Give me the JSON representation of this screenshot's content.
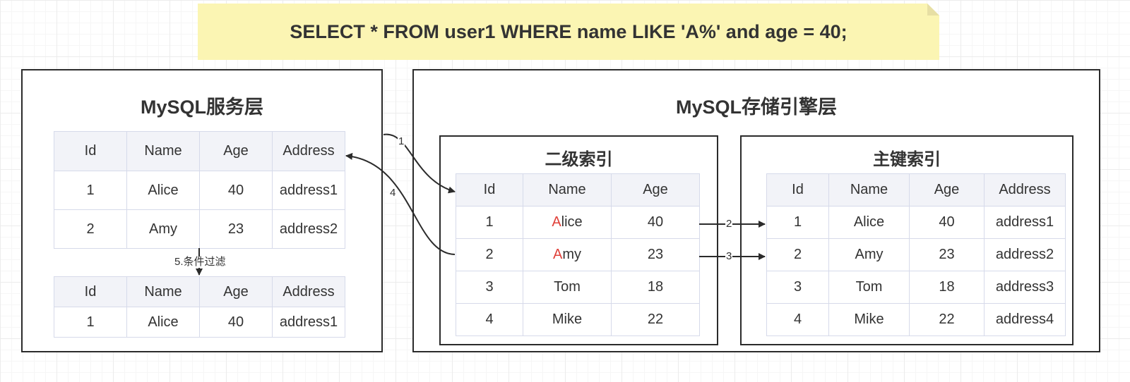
{
  "query": "SELECT * FROM user1 WHERE name LIKE 'A%' and age = 40;",
  "colors": {
    "note_bg": "#fbf5b3",
    "highlight": "#e0413a",
    "header_bg": "#f2f3f8",
    "cell_border": "#d6daea"
  },
  "server_layer": {
    "title": "MySQL服务层",
    "table1": {
      "headers": [
        "Id",
        "Name",
        "Age",
        "Address"
      ],
      "rows": [
        [
          "1",
          "Alice",
          "40",
          "address1"
        ],
        [
          "2",
          "Amy",
          "23",
          "address2"
        ]
      ]
    },
    "filter_label": "5.条件过滤",
    "table2": {
      "headers": [
        "Id",
        "Name",
        "Age",
        "Address"
      ],
      "rows": [
        [
          "1",
          "Alice",
          "40",
          "address1"
        ]
      ]
    }
  },
  "storage_layer": {
    "title": "MySQL存储引擎层",
    "secondary_index": {
      "title": "二级索引",
      "headers": [
        "Id",
        "Name",
        "Age"
      ],
      "rows": [
        [
          "1",
          "Alice",
          "40"
        ],
        [
          "2",
          "Amy",
          "23"
        ],
        [
          "3",
          "Tom",
          "18"
        ],
        [
          "4",
          "Mike",
          "22"
        ]
      ],
      "highlight_prefix": "A"
    },
    "primary_index": {
      "title": "主键索引",
      "headers": [
        "Id",
        "Name",
        "Age",
        "Address"
      ],
      "rows": [
        [
          "1",
          "Alice",
          "40",
          "address1"
        ],
        [
          "2",
          "Amy",
          "23",
          "address2"
        ],
        [
          "3",
          "Tom",
          "18",
          "address3"
        ],
        [
          "4",
          "Mike",
          "22",
          "address4"
        ]
      ]
    }
  },
  "arrow_labels": {
    "a1": "1",
    "a2": "2",
    "a3": "3",
    "a4": "4"
  }
}
